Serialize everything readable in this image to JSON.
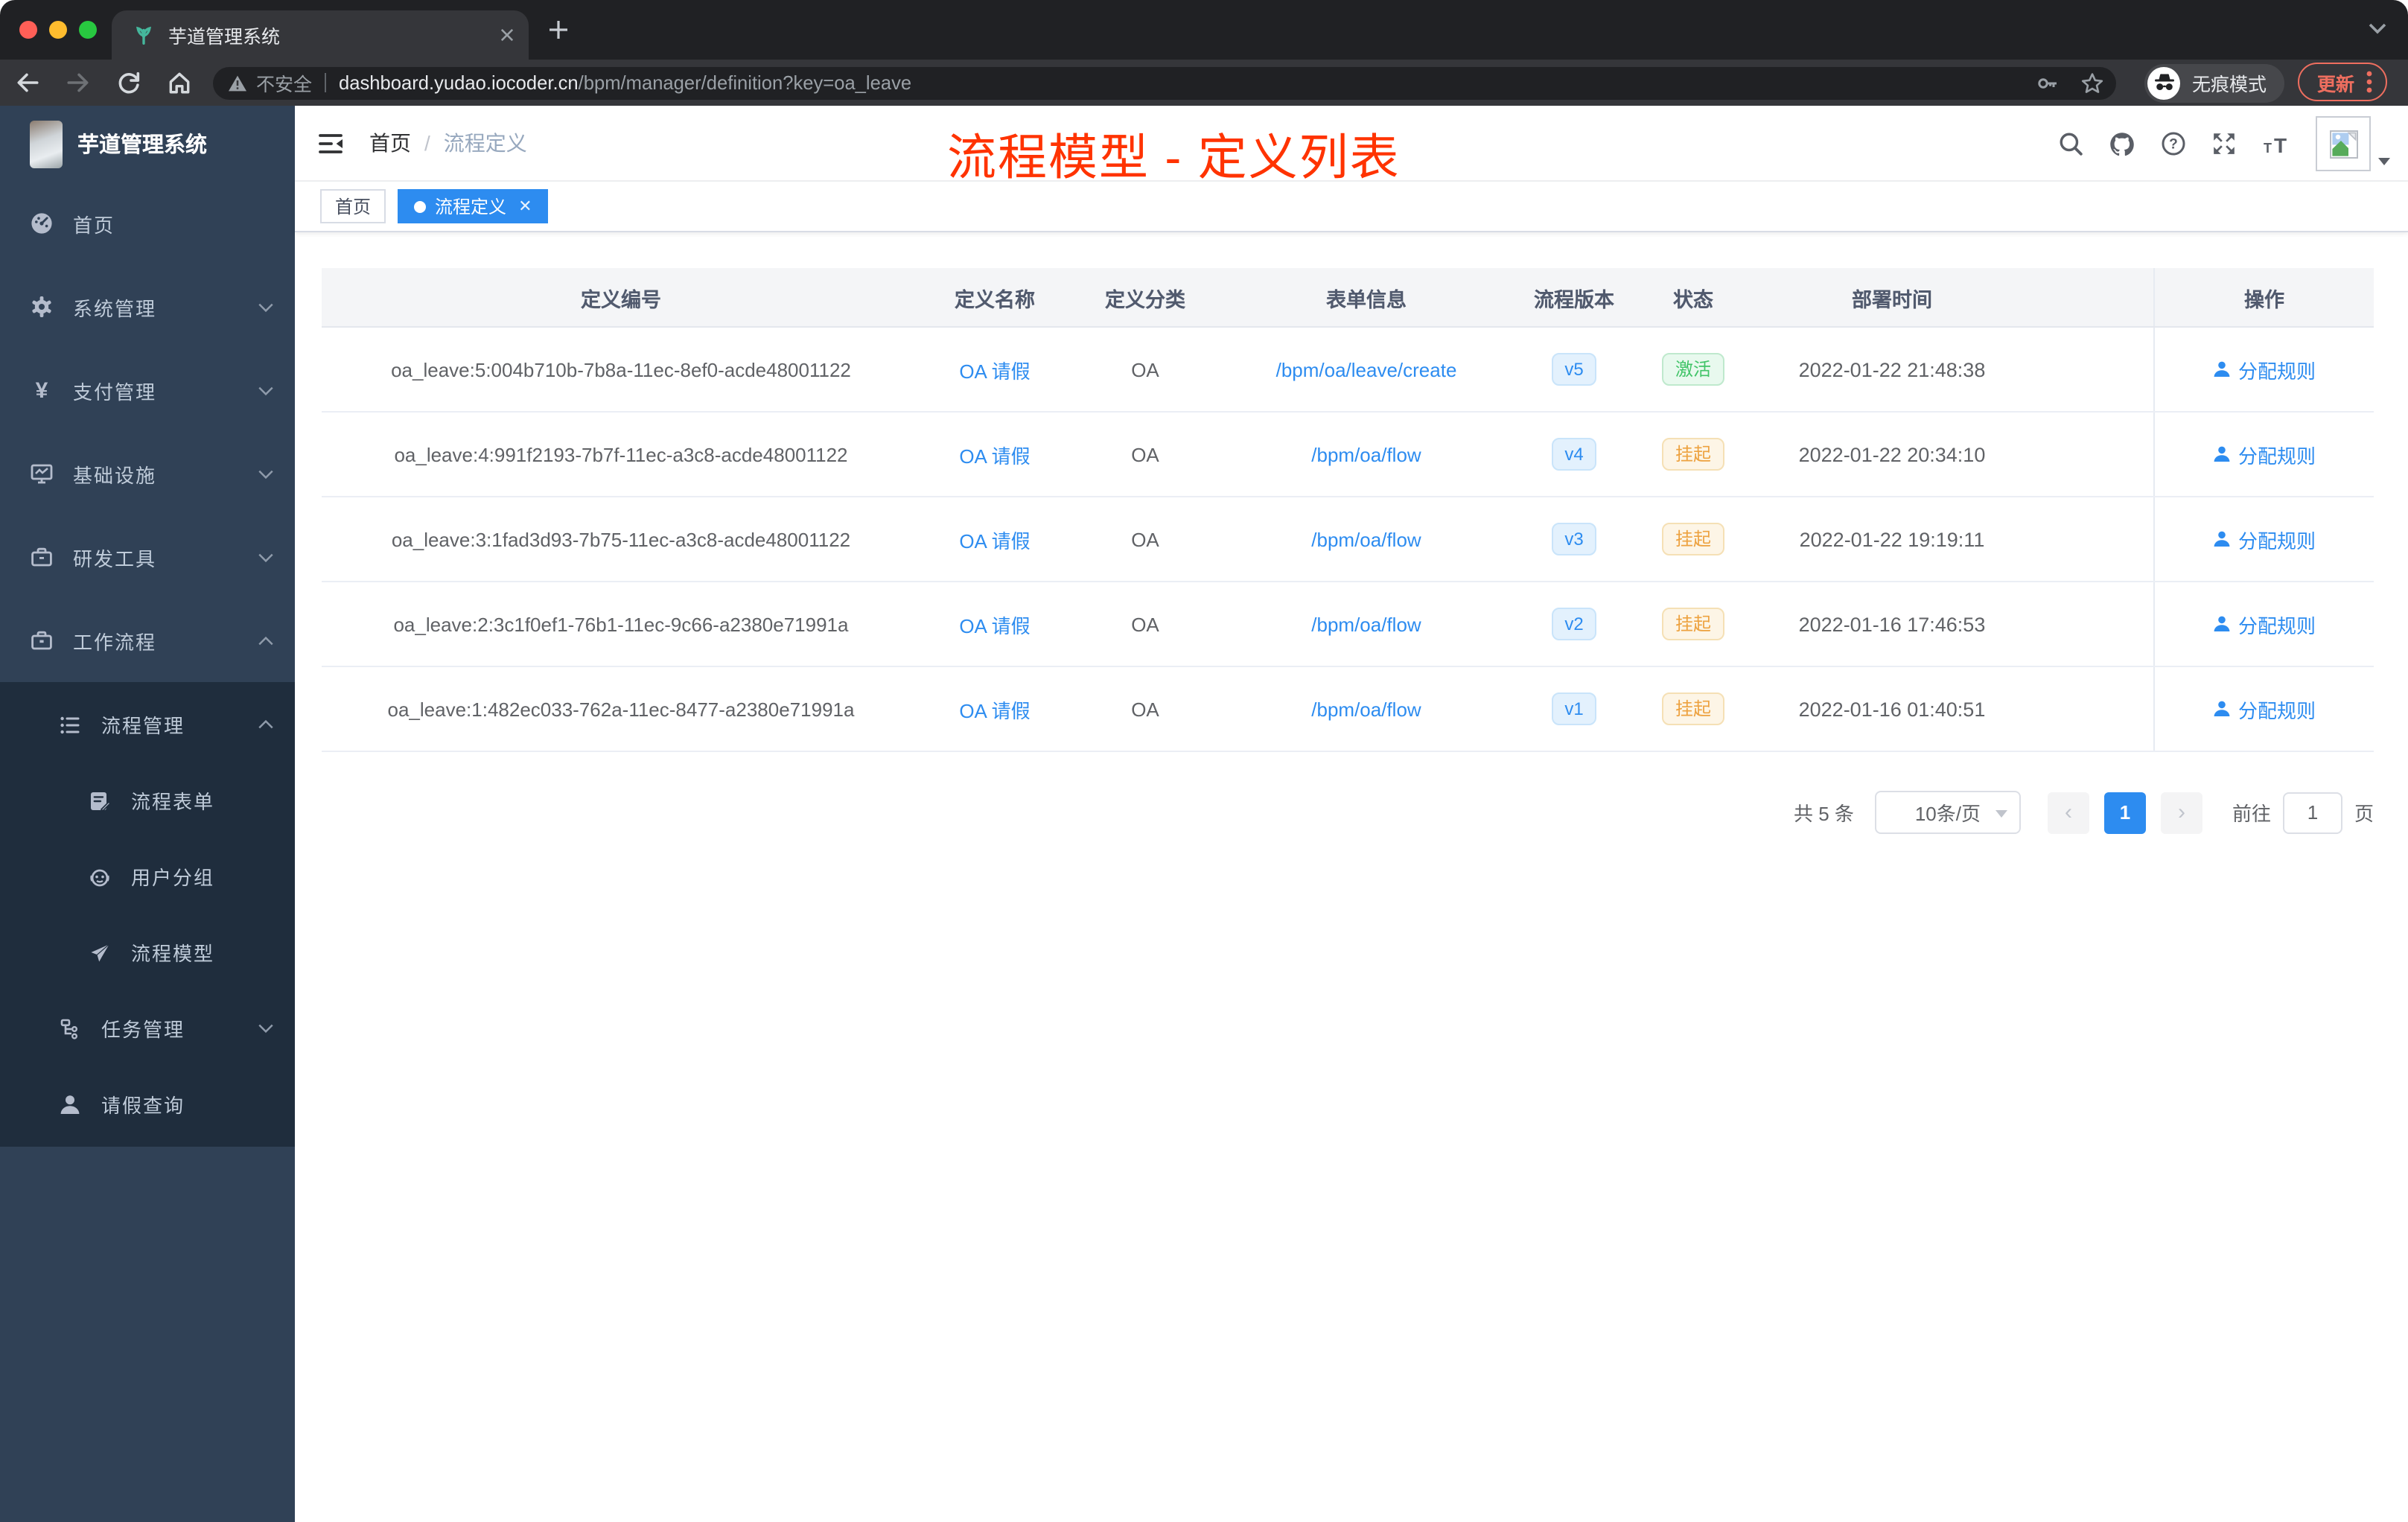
{
  "browser": {
    "tab_title": "芋道管理系统",
    "new_tab": "+",
    "security_label": "不安全",
    "url_host": "dashboard.yudao.iocoder.cn",
    "url_path": "/bpm/manager/definition?key=oa_leave",
    "incognito_label": "无痕模式",
    "update_label": "更新"
  },
  "app": {
    "logo_title": "芋道管理系统",
    "breadcrumb": {
      "home": "首页",
      "separator": "/",
      "current": "流程定义"
    },
    "annotation": {
      "text": "流程模型 - 定义列表",
      "color": "#ff3300"
    }
  },
  "tags": [
    {
      "label": "首页",
      "active": false
    },
    {
      "label": "流程定义",
      "active": true,
      "closable": true
    }
  ],
  "sidebar": {
    "items": [
      {
        "label": "首页",
        "icon": "dashboard-icon"
      },
      {
        "label": "系统管理",
        "icon": "gear-icon",
        "chevron": "down"
      },
      {
        "label": "支付管理",
        "icon": "yen-icon",
        "chevron": "down"
      },
      {
        "label": "基础设施",
        "icon": "monitor-icon",
        "chevron": "down"
      },
      {
        "label": "研发工具",
        "icon": "toolbox-icon",
        "chevron": "down"
      },
      {
        "label": "工作流程",
        "icon": "briefcase-icon",
        "chevron": "up"
      },
      {
        "label": "流程管理",
        "icon": "list-icon",
        "chevron": "up"
      },
      {
        "label": "流程表单",
        "icon": "form-icon"
      },
      {
        "label": "用户分组",
        "icon": "robot-icon"
      },
      {
        "label": "流程模型",
        "icon": "paper-plane-icon"
      },
      {
        "label": "任务管理",
        "icon": "tree-icon",
        "chevron": "down"
      },
      {
        "label": "请假查询",
        "icon": "user-icon"
      }
    ]
  },
  "table": {
    "headers": [
      "定义编号",
      "定义名称",
      "定义分类",
      "表单信息",
      "流程版本",
      "状态",
      "部署时间",
      "操作"
    ],
    "rows": [
      {
        "id": "oa_leave:5:004b710b-7b8a-11ec-8ef0-acde48001122",
        "name": "OA 请假",
        "category": "OA",
        "form": "/bpm/oa/leave/create",
        "version": "v5",
        "status": "激活",
        "status_type": "success",
        "deploy_time": "2022-01-22 21:48:38",
        "action": "分配规则"
      },
      {
        "id": "oa_leave:4:991f2193-7b7f-11ec-a3c8-acde48001122",
        "name": "OA 请假",
        "category": "OA",
        "form": "/bpm/oa/flow",
        "version": "v4",
        "status": "挂起",
        "status_type": "warning",
        "deploy_time": "2022-01-22 20:34:10",
        "action": "分配规则"
      },
      {
        "id": "oa_leave:3:1fad3d93-7b75-11ec-a3c8-acde48001122",
        "name": "OA 请假",
        "category": "OA",
        "form": "/bpm/oa/flow",
        "version": "v3",
        "status": "挂起",
        "status_type": "warning",
        "deploy_time": "2022-01-22 19:19:11",
        "action": "分配规则"
      },
      {
        "id": "oa_leave:2:3c1f0ef1-76b1-11ec-9c66-a2380e71991a",
        "name": "OA 请假",
        "category": "OA",
        "form": "/bpm/oa/flow",
        "version": "v2",
        "status": "挂起",
        "status_type": "warning",
        "deploy_time": "2022-01-16 17:46:53",
        "action": "分配规则"
      },
      {
        "id": "oa_leave:1:482ec033-762a-11ec-8477-a2380e71991a",
        "name": "OA 请假",
        "category": "OA",
        "form": "/bpm/oa/flow",
        "version": "v1",
        "status": "挂起",
        "status_type": "warning",
        "deploy_time": "2022-01-16 01:40:51",
        "action": "分配规则"
      }
    ]
  },
  "pagination": {
    "total_label": "共 5 条",
    "page_size_label": "10条/页",
    "current_page": "1",
    "goto_label": "前往",
    "page_unit": "页"
  },
  "colors": {
    "primary_blue": "#2d8cf0",
    "sidebar_bg": "#304156",
    "submenu_bg": "#1f2d3d",
    "annotation_red": "#ff3300",
    "status_active_green": "#41c468",
    "status_suspend_orange": "#eda240"
  },
  "icons": [
    "sprout-favicon",
    "back",
    "forward",
    "reload",
    "home",
    "warning",
    "key",
    "star",
    "incognito",
    "search",
    "github",
    "help",
    "fullscreen",
    "font-size",
    "avatar-placeholder",
    "hamburger",
    "user",
    "chevron"
  ]
}
